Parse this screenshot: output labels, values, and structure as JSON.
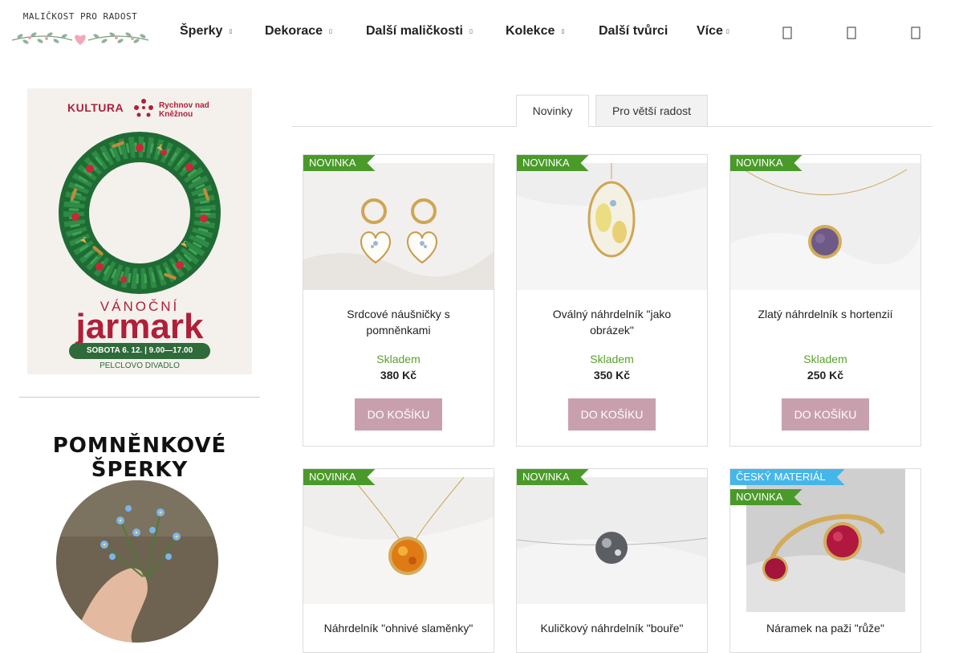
{
  "brand": {
    "logo_text": "MALIČKOST PRO RADOST"
  },
  "nav": [
    {
      "label": "Šperky",
      "has_dropdown": true
    },
    {
      "label": "Dekorace",
      "has_dropdown": true
    },
    {
      "label": "Další maličkosti",
      "has_dropdown": true
    },
    {
      "label": "Kolekce",
      "has_dropdown": true
    },
    {
      "label": "Další tvůrci",
      "has_dropdown": false
    },
    {
      "label": "Více",
      "has_dropdown": true
    }
  ],
  "header_icons": [
    "search-icon",
    "user-icon",
    "cart-icon"
  ],
  "banner": {
    "org": "KULTURA",
    "city": "Rychnov nad Kněžnou",
    "line1": "VÁNOČNÍ",
    "line2": "jarmark",
    "date": "SOBOTA 6. 12. | 9.00—17.00",
    "venue": "PELCLOVO DIVADLO"
  },
  "sidebar": {
    "heading": "POMNĚNKOVÉ ŠPERKY"
  },
  "tabs": [
    {
      "label": "Novinky",
      "active": true
    },
    {
      "label": "Pro větší radost",
      "active": false
    }
  ],
  "products": [
    {
      "badges": [
        "NOVINKA"
      ],
      "name": "Srdcové náušničky s pomněnkami",
      "stock": "Skladem",
      "price": "380 Kč",
      "button": "DO KOŠÍKU"
    },
    {
      "badges": [
        "NOVINKA"
      ],
      "name": "Oválný náhrdelník \"jako obrázek\"",
      "stock": "Skladem",
      "price": "350 Kč",
      "button": "DO KOŠÍKU"
    },
    {
      "badges": [
        "NOVINKA"
      ],
      "name": "Zlatý náhrdelník s hortenzií",
      "stock": "Skladem",
      "price": "250 Kč",
      "button": "DO KOŠÍKU"
    },
    {
      "badges": [
        "NOVINKA"
      ],
      "name": "Náhrdelník \"ohnivé slaměnky\""
    },
    {
      "badges": [
        "NOVINKA"
      ],
      "name": "Kuličkový náhrdelník \"bouře\""
    },
    {
      "badges": [
        "ČESKÝ MATERIÁL",
        "NOVINKA"
      ],
      "name": "Náramek na paži \"růže\""
    }
  ],
  "colors": {
    "badge_new": "#4a9a2a",
    "badge_czech": "#45b6ea",
    "stock_green": "#5aa02c",
    "cart_button": "#c8a0ad",
    "banner_red": "#b01f3a",
    "banner_green": "#2f6a3a"
  }
}
